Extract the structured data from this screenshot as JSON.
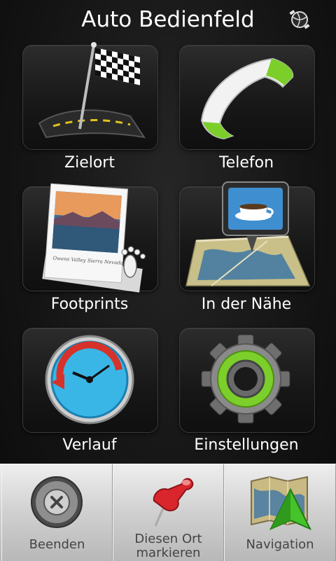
{
  "header": {
    "title": "Auto Bedienfeld",
    "status_icon": "gps-satellite-icon"
  },
  "tiles": [
    {
      "label": "Zielort",
      "icon": "checkered-flag-road-icon"
    },
    {
      "label": "Telefon",
      "icon": "phone-handset-icon"
    },
    {
      "label": "Footprints",
      "icon": "photo-footprint-icon",
      "photo_caption": "Owens Valley Sierra Nevada"
    },
    {
      "label": "In der Nähe",
      "icon": "coffee-map-pin-icon"
    },
    {
      "label": "Verlauf",
      "icon": "clock-history-icon"
    },
    {
      "label": "Einstellungen",
      "icon": "gear-icon"
    }
  ],
  "bottom_bar": {
    "exit": {
      "label": "Beenden",
      "icon": "close-circle-icon"
    },
    "mark": {
      "label_line1": "Diesen Ort",
      "label_line2": "markieren",
      "icon": "pushpin-icon"
    },
    "nav": {
      "label": "Navigation",
      "icon": "map-arrow-icon"
    }
  },
  "colors": {
    "accent_green": "#7ccf2a",
    "clock_blue": "#39b6e6",
    "background": "#161616"
  }
}
